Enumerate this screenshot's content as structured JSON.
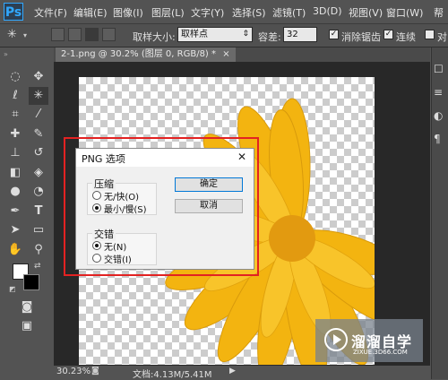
{
  "app": {
    "logo": "Ps"
  },
  "menu": [
    "文件(F)",
    "编辑(E)",
    "图像(I)",
    "图层(L)",
    "文字(Y)",
    "选择(S)",
    "滤镜(T)",
    "3D(D)",
    "视图(V)",
    "窗口(W)",
    "帮"
  ],
  "options_bar": {
    "sample_size_label": "取样大小:",
    "sample_size_value": "取样点",
    "tolerance_label": "容差:",
    "tolerance_value": "32",
    "antialias_label": "消除锯齿",
    "contiguous_label": "连续",
    "right_label": "对"
  },
  "document": {
    "tab_title": "2-1.png @ 30.2% (图层 0, RGB/8) *",
    "tab_close": "×"
  },
  "status_bar": {
    "zoom": "30.23%",
    "doc_info": "文档:4.13M/5.41M"
  },
  "dialog": {
    "title": "PNG 选项",
    "close_symbol": "✕",
    "compression": {
      "label": "压缩",
      "options": [
        "无/快(O)",
        "最小/慢(S)"
      ],
      "selected": 1
    },
    "interlace": {
      "label": "交错",
      "options": [
        "无(N)",
        "交错(I)"
      ],
      "selected": 0
    },
    "ok_label": "确定",
    "cancel_label": "取消"
  },
  "watermark": {
    "text": "溜溜自学",
    "url": "ZIXUE.3D66.COM"
  },
  "right_panel": {
    "label": "帮",
    "label2": "对"
  },
  "colors": {
    "flower_petal": "#f3b410",
    "flower_dark": "#d88a08",
    "highlight": "#e22222",
    "ps_blue": "#31a8ff"
  },
  "icons": {
    "tools": [
      "marquee-icon",
      "move-icon",
      "lasso-icon",
      "magic-wand-icon",
      "crop-icon",
      "eyedropper-icon",
      "healing-icon",
      "brush-icon",
      "stamp-icon",
      "history-brush-icon",
      "eraser-icon",
      "bucket-icon",
      "blur-icon",
      "dodge-icon",
      "pen-icon",
      "type-icon",
      "path-select-icon",
      "shape-icon",
      "hand-icon",
      "zoom-icon"
    ]
  }
}
